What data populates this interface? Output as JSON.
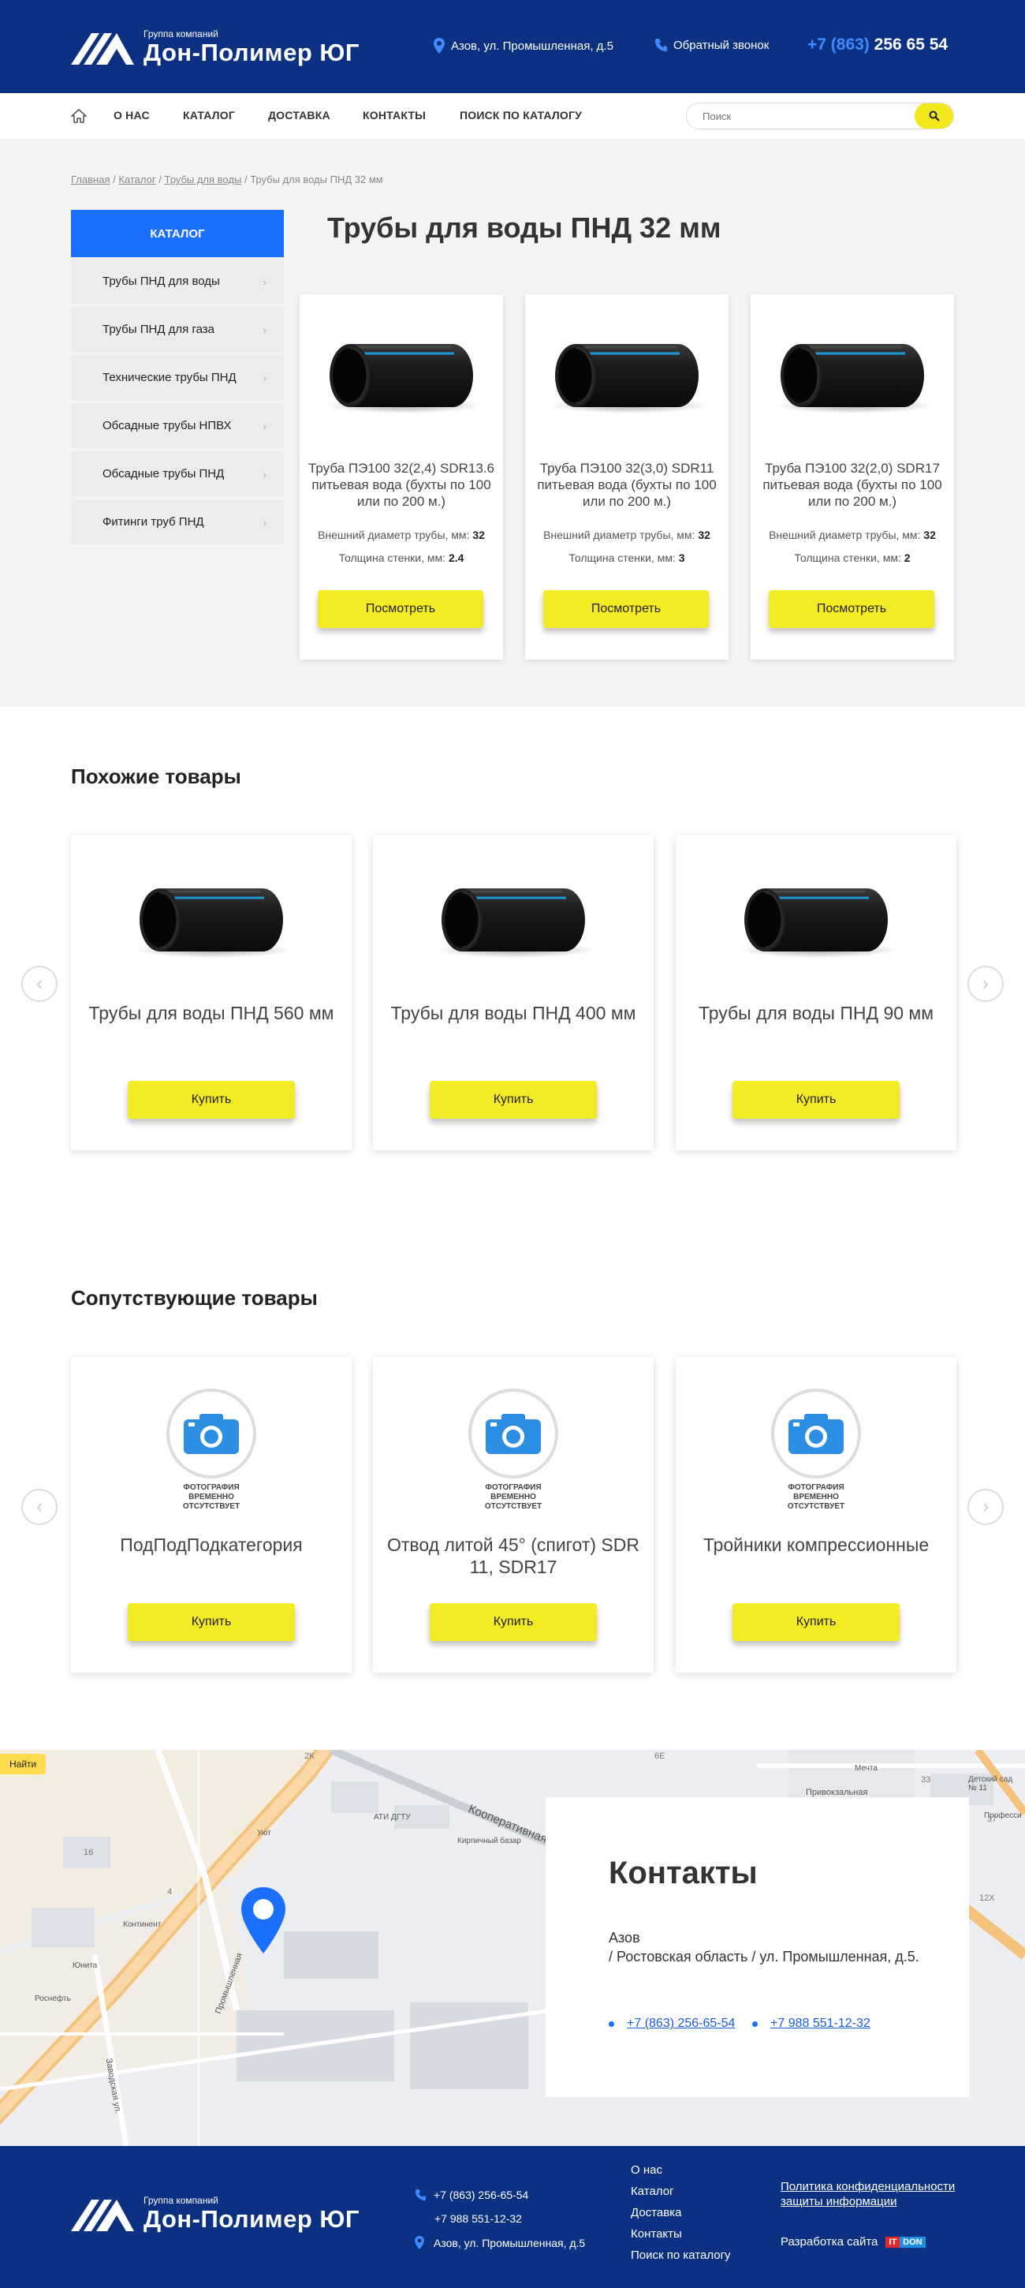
{
  "header": {
    "logo_small": "Группа компаний",
    "logo_big": "Дон-Полимер ЮГ",
    "address": "Азов, ул. Промышленная, д.5",
    "callback": "Обратный звонок",
    "phone_code": "+7 (863)",
    "phone_num": "256 65 54"
  },
  "nav": {
    "items": [
      "О НАС",
      "КАТАЛОГ",
      "ДОСТАВКА",
      "КОНТАКТЫ",
      "ПОИСК ПО КАТАЛОГУ"
    ],
    "search_placeholder": "Поиск"
  },
  "breadcrumb": {
    "home": "Главная",
    "sep1": "/",
    "catalog": "Каталог",
    "sep2": "/",
    "section": "Трубы для воды",
    "sep3": "/",
    "current": "Трубы для воды ПНД 32 мм"
  },
  "sidebar": {
    "title": "КАТАЛОГ",
    "items": [
      "Трубы ПНД для воды",
      "Трубы ПНД для газа",
      "Технические трубы ПНД",
      "Обсадные трубы НПВХ",
      "Обсадные трубы ПНД",
      "Фитинги труб ПНД"
    ]
  },
  "page_title": "Трубы для воды ПНД 32 мм",
  "products": [
    {
      "name": "Труба ПЭ100 32(2,4) SDR13.6 питьевая вода (бухты по 100 или по 200 м.)",
      "d_label": "Внешний диаметр трубы, мм:",
      "d": "32",
      "t_label": "Толщина стенки, мм:",
      "t": "2.4",
      "button": "Посмотреть"
    },
    {
      "name": "Труба ПЭ100 32(3,0) SDR11 питьевая вода (бухты по 100 или по 200 м.)",
      "d_label": "Внешний диаметр трубы, мм:",
      "d": "32",
      "t_label": "Толщина стенки, мм:",
      "t": "3",
      "button": "Посмотреть"
    },
    {
      "name": "Труба ПЭ100 32(2,0) SDR17 питьевая вода (бухты по 100 или по 200 м.)",
      "d_label": "Внешний диаметр трубы, мм:",
      "d": "32",
      "t_label": "Толщина стенки, мм:",
      "t": "2",
      "button": "Посмотреть"
    }
  ],
  "similar": {
    "title": "Похожие товары",
    "items": [
      {
        "name": "Трубы для воды ПНД 560 мм",
        "button": "Купить"
      },
      {
        "name": "Трубы для воды ПНД 400 мм",
        "button": "Купить"
      },
      {
        "name": "Трубы для воды ПНД 90 мм",
        "button": "Купить"
      }
    ]
  },
  "related": {
    "title": "Сопутствующие товары",
    "nophoto": "ФОТОГРАФИЯ ВРЕМЕННО ОТСУТСТВУЕТ",
    "items": [
      {
        "name": "ПодПодПодкатегория",
        "button": "Купить"
      },
      {
        "name": "Отвод литой 45° (спигот) SDR 11, SDR17",
        "button": "Купить"
      },
      {
        "name": "Тройники компрессионные",
        "button": "Купить"
      }
    ]
  },
  "map": {
    "find": "Найти",
    "labels": [
      "Кооперативная ул.",
      "Промышленная",
      "Заводская ул.",
      "Привокзальная",
      "АТИ ДГТУ",
      "Кирпичный базар",
      "Уют",
      "Континент",
      "Юнита",
      "Роснефть",
      "Мечта",
      "Детский сад № 11",
      "Професси",
      "2К",
      "6Е",
      "33",
      "37",
      "12Х",
      "16",
      "4"
    ]
  },
  "contacts": {
    "title": "Контакты",
    "city": "Азов",
    "address": "/ Ростовская область / ул. Промышленная, д.5.",
    "phone1": "+7 (863) 256-65-54",
    "phone2": "+7 988 551-12-32"
  },
  "footer": {
    "logo_small": "Группа компаний",
    "logo_big": "Дон-Полимер ЮГ",
    "phone1": "+7 (863) 256-65-54",
    "phone2": "+7 988 551-12-32",
    "address": "Азов, ул. Промышленная, д.5",
    "links": [
      "О нас",
      "Каталог",
      "Доставка",
      "Контакты",
      "Поиск по каталогу"
    ],
    "privacy": "Политика конфиденциальности",
    "privacy2": "защиты информации",
    "dev": "Разработка сайта",
    "dev_it": "IT",
    "dev_don": "DON"
  },
  "colors": {
    "header_bg": "#0c3182",
    "accent_blue": "#1a6ffd",
    "button_yellow": "#f3eb24",
    "pin": "#1a6ffd"
  }
}
